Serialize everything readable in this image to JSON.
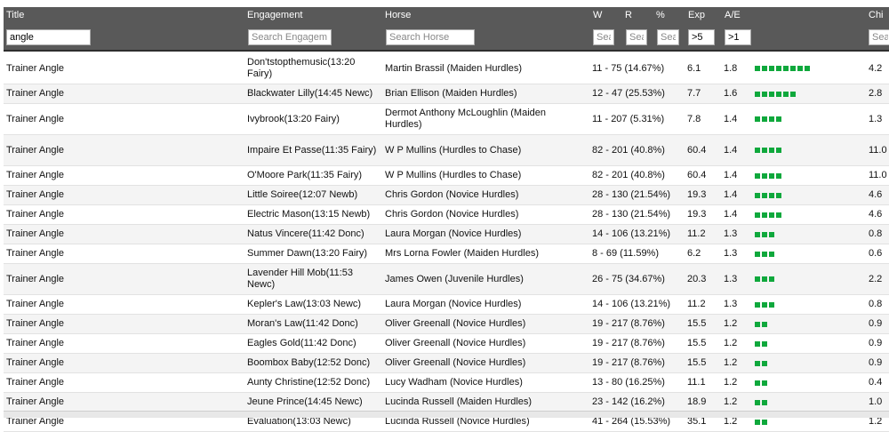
{
  "headers": {
    "title": "Title",
    "engagement": "Engagement",
    "horse": "Horse",
    "w": "W",
    "r": "R",
    "pct": "%",
    "exp": "Exp",
    "ae": "A/E",
    "chi": "Chi"
  },
  "filters": {
    "title_value": "angle",
    "engagement_placeholder": "Search Engagem",
    "horse_placeholder": "Search Horse",
    "w_placeholder": "Sea",
    "r_placeholder": "Sea",
    "pct_placeholder": "Sea",
    "exp_value": ">5",
    "ae_value": ">1",
    "chi_placeholder": "Sea"
  },
  "colors": {
    "header_bg": "#595959",
    "bar_green": "#0fa83c"
  },
  "rows": [
    {
      "title": "Trainer Angle",
      "engagement": "Don'tstopthemusic(13:20 Fairy)",
      "horse": "Martin Brassil (Maiden Hurdles)",
      "wr": "11 - 75 (14.67%)",
      "exp": "6.1",
      "ae": "1.8",
      "bars": 8,
      "chi": "4.2"
    },
    {
      "title": "Trainer Angle",
      "engagement": "Blackwater Lilly(14:45 Newc)",
      "horse": "Brian Ellison (Maiden Hurdles)",
      "wr": "12 - 47 (25.53%)",
      "exp": "7.7",
      "ae": "1.6",
      "bars": 6,
      "chi": "2.8"
    },
    {
      "title": "Trainer Angle",
      "engagement": "Ivybrook(13:20 Fairy)",
      "horse": "Dermot Anthony McLoughlin (Maiden Hurdles)",
      "wr": "11 - 207 (5.31%)",
      "exp": "7.8",
      "ae": "1.4",
      "bars": 4,
      "chi": "1.3"
    },
    {
      "title": "Trainer Angle",
      "engagement": "Impaire Et Passe(11:35 Fairy)",
      "horse": "W P Mullins (Hurdles to Chase)",
      "wr": "82 - 201 (40.8%)",
      "exp": "60.4",
      "ae": "1.4",
      "bars": 4,
      "chi": "11.0"
    },
    {
      "title": "Trainer Angle",
      "engagement": "O'Moore Park(11:35 Fairy)",
      "horse": "W P Mullins (Hurdles to Chase)",
      "wr": "82 - 201 (40.8%)",
      "exp": "60.4",
      "ae": "1.4",
      "bars": 4,
      "chi": "11.0"
    },
    {
      "title": "Trainer Angle",
      "engagement": "Little Soiree(12:07 Newb)",
      "horse": "Chris Gordon (Novice Hurdles)",
      "wr": "28 - 130 (21.54%)",
      "exp": "19.3",
      "ae": "1.4",
      "bars": 4,
      "chi": "4.6"
    },
    {
      "title": "Trainer Angle",
      "engagement": "Electric Mason(13:15 Newb)",
      "horse": "Chris Gordon (Novice Hurdles)",
      "wr": "28 - 130 (21.54%)",
      "exp": "19.3",
      "ae": "1.4",
      "bars": 4,
      "chi": "4.6"
    },
    {
      "title": "Trainer Angle",
      "engagement": "Natus Vincere(11:42 Donc)",
      "horse": "Laura Morgan (Novice Hurdles)",
      "wr": "14 - 106 (13.21%)",
      "exp": "11.2",
      "ae": "1.3",
      "bars": 3,
      "chi": "0.8"
    },
    {
      "title": "Trainer Angle",
      "engagement": "Summer Dawn(13:20 Fairy)",
      "horse": "Mrs Lorna Fowler (Maiden Hurdles)",
      "wr": "8 - 69 (11.59%)",
      "exp": "6.2",
      "ae": "1.3",
      "bars": 3,
      "chi": "0.6"
    },
    {
      "title": "Trainer Angle",
      "engagement": "Lavender Hill Mob(11:53 Newc)",
      "horse": "James Owen (Juvenile Hurdles)",
      "wr": "26 - 75 (34.67%)",
      "exp": "20.3",
      "ae": "1.3",
      "bars": 3,
      "chi": "2.2"
    },
    {
      "title": "Trainer Angle",
      "engagement": "Kepler's Law(13:03 Newc)",
      "horse": "Laura Morgan (Novice Hurdles)",
      "wr": "14 - 106 (13.21%)",
      "exp": "11.2",
      "ae": "1.3",
      "bars": 3,
      "chi": "0.8"
    },
    {
      "title": "Trainer Angle",
      "engagement": "Moran's Law(11:42 Donc)",
      "horse": "Oliver Greenall (Novice Hurdles)",
      "wr": "19 - 217 (8.76%)",
      "exp": "15.5",
      "ae": "1.2",
      "bars": 2,
      "chi": "0.9"
    },
    {
      "title": "Trainer Angle",
      "engagement": "Eagles Gold(11:42 Donc)",
      "horse": "Oliver Greenall (Novice Hurdles)",
      "wr": "19 - 217 (8.76%)",
      "exp": "15.5",
      "ae": "1.2",
      "bars": 2,
      "chi": "0.9"
    },
    {
      "title": "Trainer Angle",
      "engagement": "Boombox Baby(12:52 Donc)",
      "horse": "Oliver Greenall (Novice Hurdles)",
      "wr": "19 - 217 (8.76%)",
      "exp": "15.5",
      "ae": "1.2",
      "bars": 2,
      "chi": "0.9"
    },
    {
      "title": "Trainer Angle",
      "engagement": "Aunty Christine(12:52 Donc)",
      "horse": "Lucy Wadham (Novice Hurdles)",
      "wr": "13 - 80 (16.25%)",
      "exp": "11.1",
      "ae": "1.2",
      "bars": 2,
      "chi": "0.4"
    },
    {
      "title": "Trainer Angle",
      "engagement": "Jeune Prince(14:45 Newc)",
      "horse": "Lucinda Russell (Maiden Hurdles)",
      "wr": "23 - 142 (16.2%)",
      "exp": "18.9",
      "ae": "1.2",
      "bars": 2,
      "chi": "1.0"
    },
    {
      "title": "Trainer Angle",
      "engagement": "Evaluation(13:03 Newc)",
      "horse": "Lucinda Russell (Novice Hurdles)",
      "wr": "41 - 264 (15.53%)",
      "exp": "35.1",
      "ae": "1.2",
      "bars": 2,
      "chi": "1.2"
    }
  ]
}
